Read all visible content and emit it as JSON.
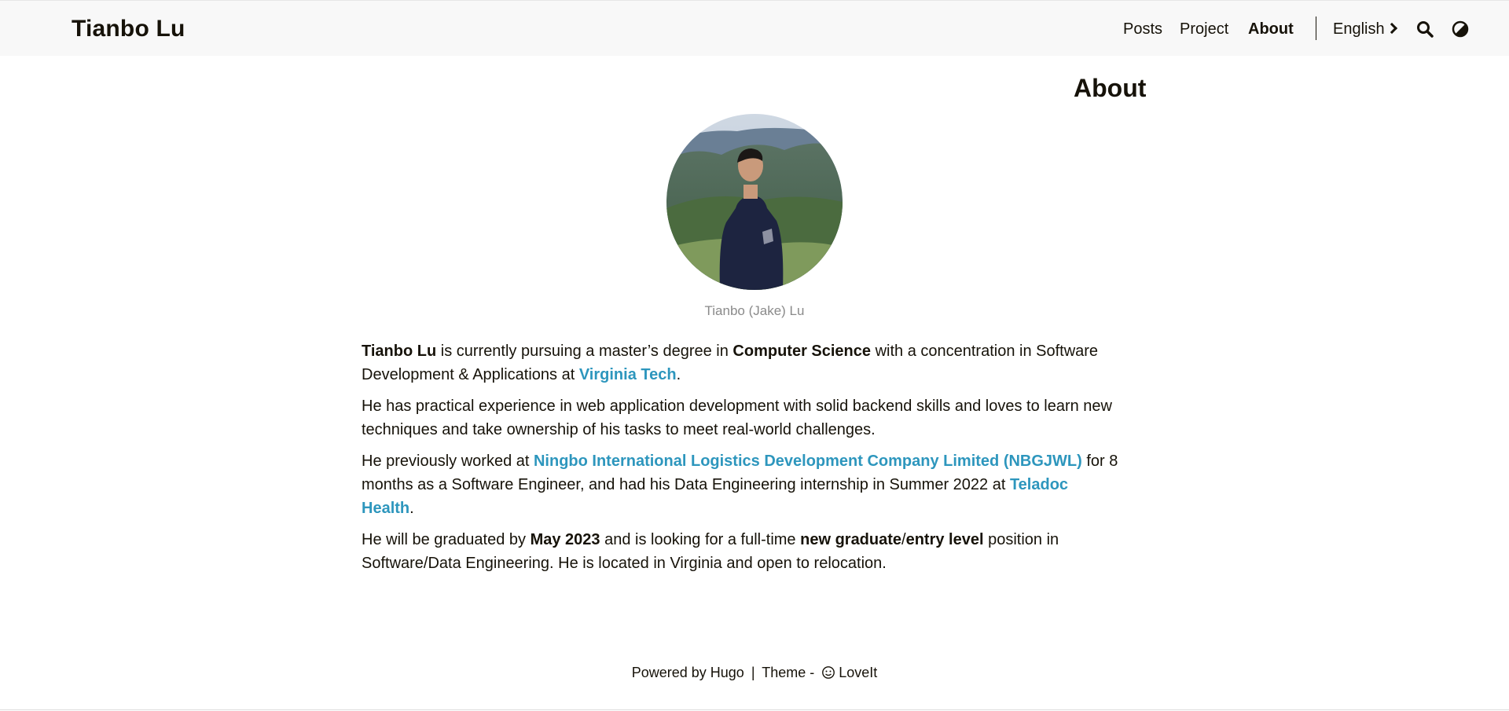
{
  "header": {
    "logo": "Tianbo Lu",
    "nav": [
      "Posts",
      "Project",
      "About"
    ],
    "active_nav": "About",
    "language": "English",
    "icons": [
      "chevron-right-icon",
      "search-icon",
      "theme-toggle-icon"
    ]
  },
  "main": {
    "title": "About",
    "avatar_caption": "Tianbo (Jake) Lu",
    "p1": {
      "name": "Tianbo Lu",
      "t1": " is currently pursuing a master’s degree in ",
      "field": "Computer Science",
      "t2": " with a concentration in Software Development & Applications at ",
      "school": "Virginia Tech",
      "t3": "."
    },
    "p2": "He has practical experience in web application development with solid backend skills and loves to learn new techniques and take ownership of his tasks to meet real-world challenges.",
    "p3": {
      "t1": "He previously worked at ",
      "company": "Ningbo International Logistics Development Company Limited (NBGJWL)",
      "t2": " for 8 months as a Software Engineer, and had his Data Engineering internship in Summer 2022 at ",
      "company2": "Teladoc Health",
      "t3": "."
    },
    "p4": {
      "t1": "He will be graduated by ",
      "date": "May 2023",
      "t2": " and is looking for a full-time ",
      "role1": "new graduate",
      "slash": "/",
      "role2": "entry level",
      "t3": " position in Software/Data Engineering. He is located in Virginia and open to relocation."
    }
  },
  "footer": {
    "powered": "Powered by Hugo",
    "sep": "|",
    "theme_prefix": "Theme - ",
    "theme_name": "LoveIt"
  },
  "colors": {
    "link": "#2d96bd",
    "header_bg": "#f8f8f8",
    "text": "#161209"
  }
}
